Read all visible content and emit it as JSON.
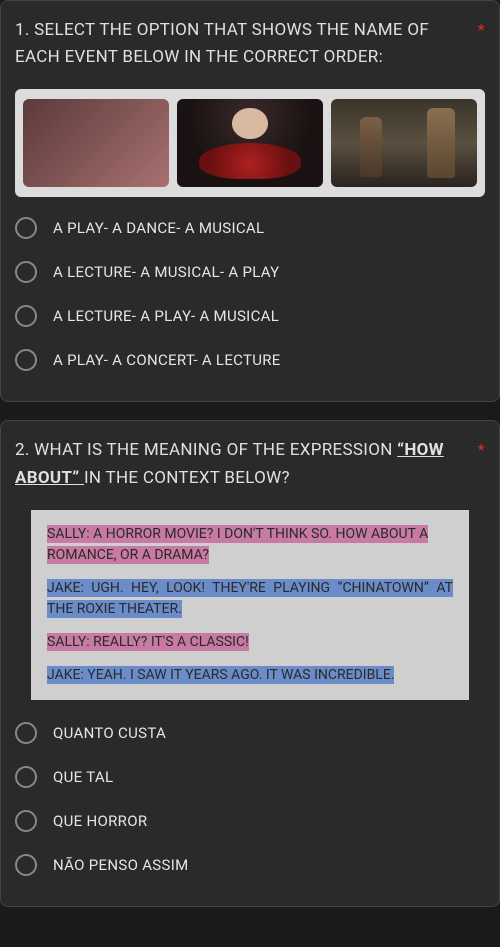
{
  "q1": {
    "text": "1. SELECT THE OPTION THAT SHOWS THE NAME OF EACH EVENT BELOW IN THE CORRECT ORDER:",
    "required": "*",
    "options": [
      "A PLAY- A DANCE- A MUSICAL",
      "A LECTURE- A MUSICAL- A PLAY",
      "A LECTURE- A PLAY- A MUSICAL",
      "A PLAY- A CONCERT- A LECTURE"
    ]
  },
  "q2": {
    "text_pre": "2. WHAT IS THE MEANING OF THE EXPRESSION ",
    "text_underline": "“HOW ABOUT” ",
    "text_post": "IN THE CONTEXT BELOW?",
    "required": "*",
    "dialog": {
      "sally1": "SALLY: A HORROR MOVIE? I DON'T THINK SO. HOW ABOUT A ROMANCE, OR A DRAMA?",
      "jake1": "JAKE: UGH. HEY, LOOK! THEY'RE PLAYING “CHINATOWN” AT THE ROXIE THEATER.",
      "sally2": "SALLY: REALLY? IT'S A CLASSIC!",
      "jake2": "JAKE: YEAH. I SAW IT YEARS AGO. IT WAS INCREDIBLE."
    },
    "options": [
      "QUANTO CUSTA",
      "QUE TAL",
      "QUE HORROR",
      "NÃO PENSO ASSIM"
    ]
  }
}
